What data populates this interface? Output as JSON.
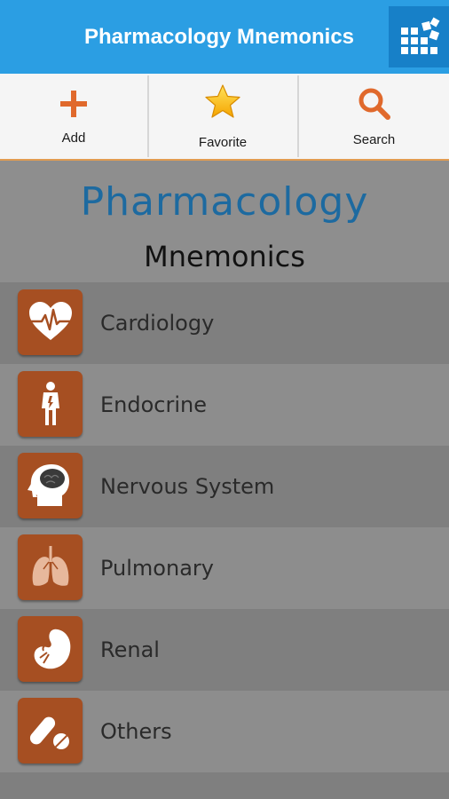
{
  "appbar": {
    "title": "Pharmacology Mnemonics",
    "menu_icon": "grid-icon",
    "color": "#2b9ee3"
  },
  "toolbar": {
    "items": [
      {
        "label": "Add",
        "icon": "plus-icon"
      },
      {
        "label": "Favorite",
        "icon": "star-icon"
      },
      {
        "label": "Search",
        "icon": "search-icon"
      }
    ],
    "accent": "#e19c52"
  },
  "banner": {
    "title": "Pharmacology",
    "subtitle": "Mnemonics"
  },
  "categories": [
    {
      "label": "Cardiology",
      "icon": "heart-icon"
    },
    {
      "label": "Endocrine",
      "icon": "body-icon"
    },
    {
      "label": "Nervous System",
      "icon": "brain-icon"
    },
    {
      "label": "Pulmonary",
      "icon": "lungs-icon"
    },
    {
      "label": "Renal",
      "icon": "kidney-icon"
    },
    {
      "label": "Others",
      "icon": "pill-icon"
    }
  ],
  "tile_color": "#a64f22"
}
